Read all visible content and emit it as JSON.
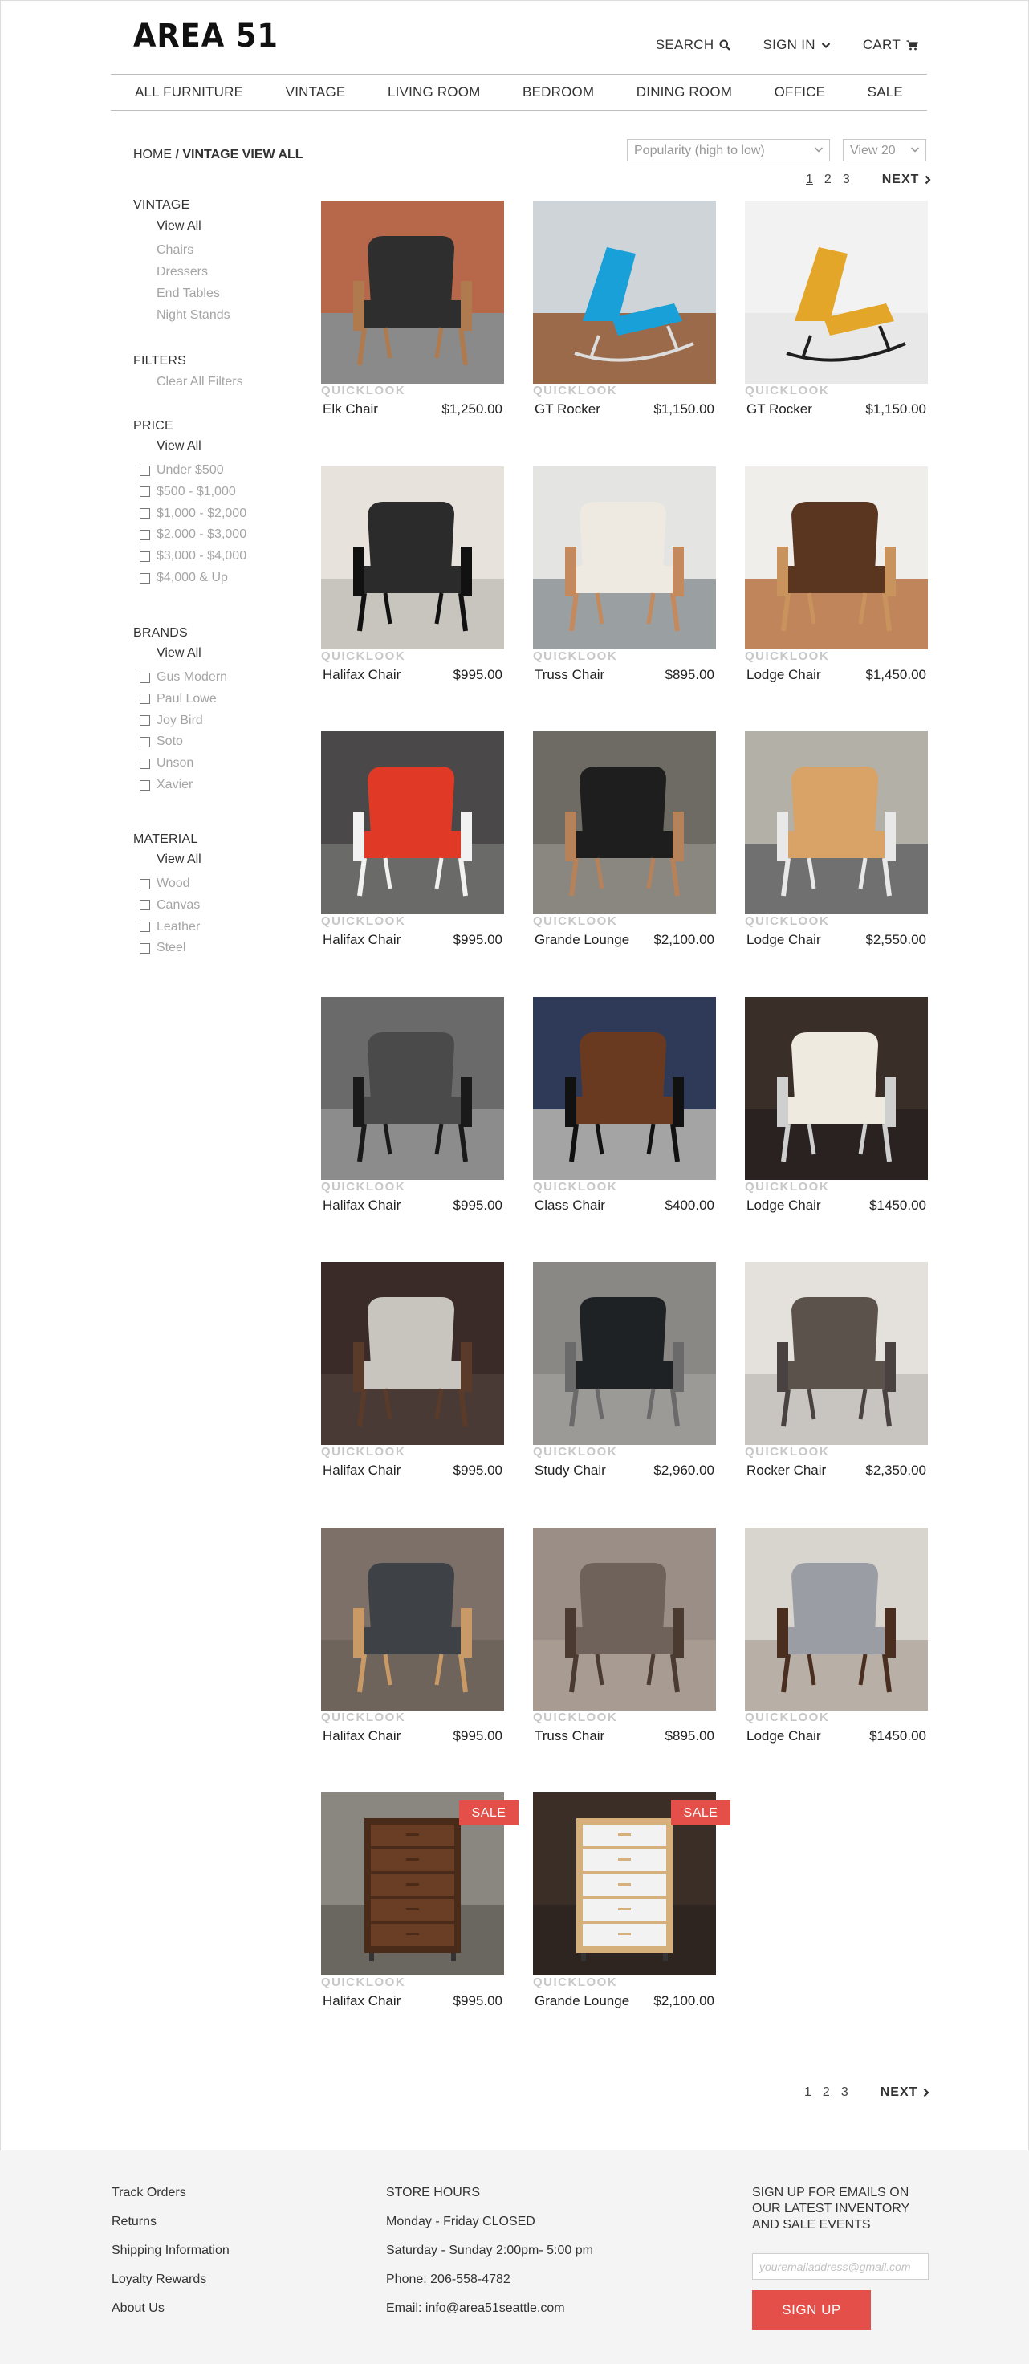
{
  "header": {
    "logo": "AREA 51",
    "search_label": "SEARCH",
    "signin_label": "SIGN IN",
    "cart_label": "CART"
  },
  "nav": [
    "ALL FURNITURE",
    "VINTAGE",
    "LIVING ROOM",
    "BEDROOM",
    "DINING ROOM",
    "OFFICE",
    "SALE"
  ],
  "breadcrumb": {
    "home": "HOME",
    "sep": " / ",
    "current": "VINTAGE VIEW ALL"
  },
  "sort": {
    "selected": "Popularity (high to low)"
  },
  "view": {
    "selected": "View 20"
  },
  "pagination": {
    "pages": [
      "1",
      "2",
      "3"
    ],
    "current": "1",
    "next_label": "NEXT"
  },
  "sidebar": {
    "vintage": {
      "heading": "VINTAGE",
      "view_all": "View All",
      "items": [
        "Chairs",
        "Dressers",
        "End Tables",
        "Night Stands"
      ]
    },
    "filters": {
      "heading": "FILTERS",
      "clear": "Clear All Filters"
    },
    "price": {
      "heading": "PRICE",
      "view_all": "View All",
      "options": [
        "Under $500",
        "$500 - $1,000",
        "$1,000 - $2,000",
        "$2,000 - $3,000",
        "$3,000 - $4,000",
        "$4,000 & Up"
      ]
    },
    "brands": {
      "heading": "BRANDS",
      "view_all": "View All",
      "options": [
        "Gus Modern",
        "Paul Lowe",
        "Joy Bird",
        "Soto",
        "Unson",
        "Xavier"
      ]
    },
    "material": {
      "heading": "MATERIAL",
      "view_all": "View All",
      "options": [
        "Wood",
        "Canvas",
        "Leather",
        "Steel"
      ]
    }
  },
  "quicklook_label": "QUICKLOOK",
  "sale_label": "SALE",
  "products": [
    {
      "name": "Elk Chair",
      "price": "$1,250.00",
      "kind": "chair",
      "seat": "#2e2e2e",
      "frame": "#b07a4f",
      "bg": "#b8684a",
      "floor": "#8a8a8a"
    },
    {
      "name": "GT Rocker",
      "price": "$1,150.00",
      "kind": "rocker",
      "seat": "#1aa0d8",
      "frame": "#dddddd",
      "bg": "#cfd4d8",
      "floor": "#9a6a4a"
    },
    {
      "name": "GT Rocker",
      "price": "$1,150.00",
      "kind": "rocker",
      "seat": "#e3a628",
      "frame": "#1e1e1e",
      "bg": "#f2f2f2",
      "floor": "#e8e8e8"
    },
    {
      "name": "Halifax Chair",
      "price": "$995.00",
      "kind": "chair",
      "seat": "#2b2b2b",
      "frame": "#111111",
      "bg": "#e7e2dc",
      "floor": "#c8c4be"
    },
    {
      "name": "Truss Chair",
      "price": "$895.00",
      "kind": "chair",
      "seat": "#eeeae2",
      "frame": "#c48a5d",
      "bg": "#e4e4e2",
      "floor": "#9aa0a2"
    },
    {
      "name": "Lodge Chair",
      "price": "$1,450.00",
      "kind": "chair",
      "seat": "#5a3520",
      "frame": "#c9935d",
      "bg": "#f0eeea",
      "floor": "#c0855a"
    },
    {
      "name": "Halifax Chair",
      "price": "$995.00",
      "kind": "chair",
      "seat": "#e03a26",
      "frame": "#f2f2f2",
      "bg": "#4a4848",
      "floor": "#6a6a68"
    },
    {
      "name": "Grande Lounge",
      "price": "$2,100.00",
      "kind": "chair",
      "seat": "#1e1e1e",
      "frame": "#b5825a",
      "bg": "#6e6a64",
      "floor": "#8a8680"
    },
    {
      "name": "Lodge Chair",
      "price": "$2,550.00",
      "kind": "chair",
      "seat": "#d9a266",
      "frame": "#e8e8e8",
      "bg": "#b3b0a8",
      "floor": "#707070"
    },
    {
      "name": "Halifax Chair",
      "price": "$995.00",
      "kind": "chair",
      "seat": "#4a4a4a",
      "frame": "#1a1a1a",
      "bg": "#6a6a6a",
      "floor": "#8c8c8c"
    },
    {
      "name": "Class Chair",
      "price": "$400.00",
      "kind": "chair",
      "seat": "#6a3a20",
      "frame": "#111111",
      "bg": "#2e3a58",
      "floor": "#a4a4a4"
    },
    {
      "name": "Lodge Chair",
      "price": "$1450.00",
      "kind": "chair",
      "seat": "#efeadf",
      "frame": "#cfcfcf",
      "bg": "#3a2e28",
      "floor": "#2a2220"
    },
    {
      "name": "Halifax Chair",
      "price": "$995.00",
      "kind": "chair",
      "seat": "#c8c4be",
      "frame": "#5a3a28",
      "bg": "#3a2a28",
      "floor": "#4a3a36"
    },
    {
      "name": "Study Chair",
      "price": "$2,960.00",
      "kind": "chair",
      "seat": "#1e2224",
      "frame": "#6a6a6a",
      "bg": "#8a8884",
      "floor": "#9c9a96"
    },
    {
      "name": "Rocker Chair",
      "price": "$2,350.00",
      "kind": "chair",
      "seat": "#5c524c",
      "frame": "#4a4240",
      "bg": "#e4e0dc",
      "floor": "#c8c4c0"
    },
    {
      "name": "Halifax Chair",
      "price": "$995.00",
      "kind": "chair",
      "seat": "#3e4246",
      "frame": "#c99a66",
      "bg": "#7c7068",
      "floor": "#6e645c"
    },
    {
      "name": "Truss Chair",
      "price": "$895.00",
      "kind": "chair",
      "seat": "#6e625a",
      "frame": "#4a3a30",
      "bg": "#9a8e86",
      "floor": "#a89c92"
    },
    {
      "name": "Lodge Chair",
      "price": "$1450.00",
      "kind": "chair",
      "seat": "#9a9ea4",
      "frame": "#4a2e20",
      "bg": "#d8d4ce",
      "floor": "#b8b0a6"
    },
    {
      "name": "Halifax Chair",
      "price": "$995.00",
      "kind": "dresser",
      "seat": "#6a3e24",
      "frame": "#4a2a18",
      "bg": "#8a8680",
      "floor": "#6a6660",
      "sale": true
    },
    {
      "name": "Grande Lounge",
      "price": "$2,100.00",
      "kind": "dresser",
      "seat": "#f2f2f2",
      "frame": "#d6b07a",
      "bg": "#3a2e26",
      "floor": "#2e2420",
      "sale": true
    }
  ],
  "footer": {
    "links": [
      "Track Orders",
      "Returns",
      "Shipping Information",
      "Loyalty Rewards",
      "About Us"
    ],
    "store_hours": [
      "STORE HOURS",
      "Monday - Friday CLOSED",
      "Saturday - Sunday 2:00pm- 5:00 pm",
      "Phone: 206-558-4782",
      "Email: info@area51seattle.com"
    ],
    "signup_heading": "SIGN UP FOR EMAILS ON OUR LATEST INVENTORY AND SALE EVENTS",
    "email_placeholder": "youremailaddress@gmail.com",
    "signup_button": "SIGN UP"
  },
  "colors": {
    "accent": "#e45049",
    "footer_bg": "#f4f4f4",
    "muted_text": "#a5a5a5"
  }
}
